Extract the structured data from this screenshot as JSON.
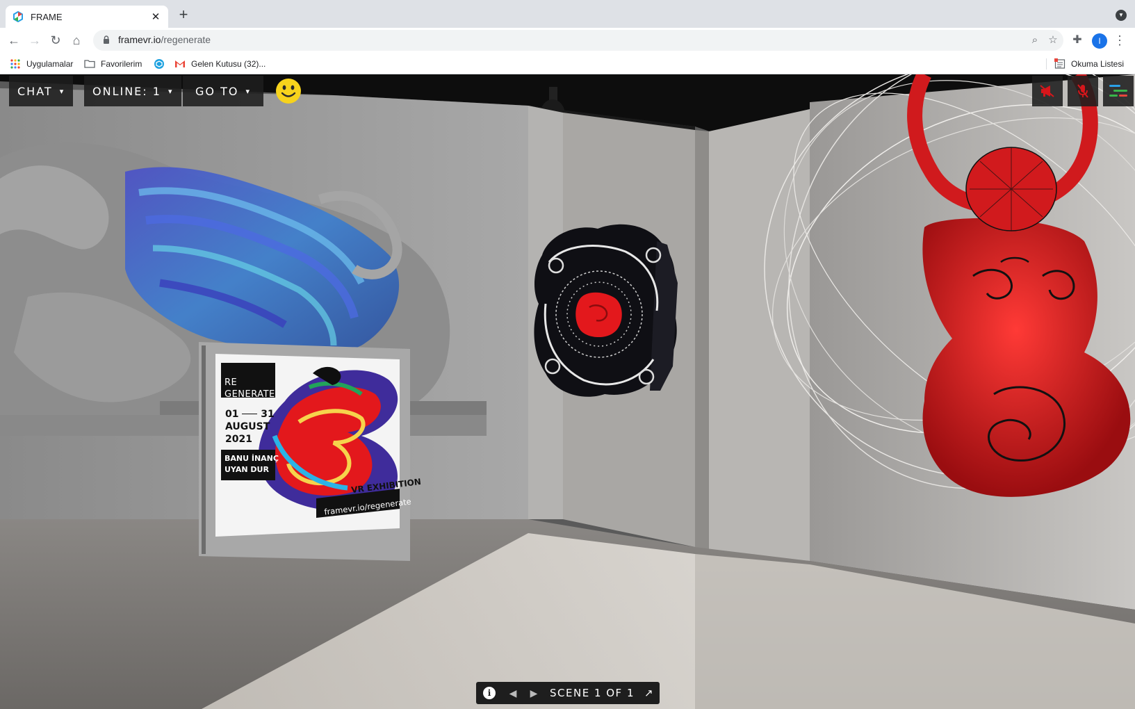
{
  "browser": {
    "tab_title": "FRAME",
    "url_domain": "framevr.io",
    "url_path": "/regenerate",
    "profile_initial": "I",
    "bookmarks": [
      {
        "label": "Uygulamalar",
        "icon": "apps-grid-icon"
      },
      {
        "label": "Favorilerim",
        "icon": "folder-icon"
      },
      {
        "label": "",
        "icon": "globe-icon"
      },
      {
        "label": "Gelen Kutusu (32)...",
        "icon": "gmail-icon"
      }
    ],
    "reading_list": "Okuma Listesi"
  },
  "hud": {
    "chat": "CHAT",
    "online": "ONLINE: 1",
    "goto": "GO TO"
  },
  "scene_bar": {
    "label": "SCENE 1 OF 1"
  },
  "poster": {
    "title_line1": "RE",
    "title_line2": "GENERATE",
    "date_start": "01",
    "date_end": "31",
    "month": "AUGUST",
    "year": "2021",
    "artist1": "BANU İNANÇ",
    "artist2": "UYAN DUR",
    "subtitle": "VR EXHIBITION",
    "site": "framevr.io/regenerate"
  },
  "colors": {
    "accent_red": "#d8161b",
    "hud_bg": "#1e1e1e",
    "smiley": "#f7d31c",
    "profile": "#1a73e8"
  }
}
